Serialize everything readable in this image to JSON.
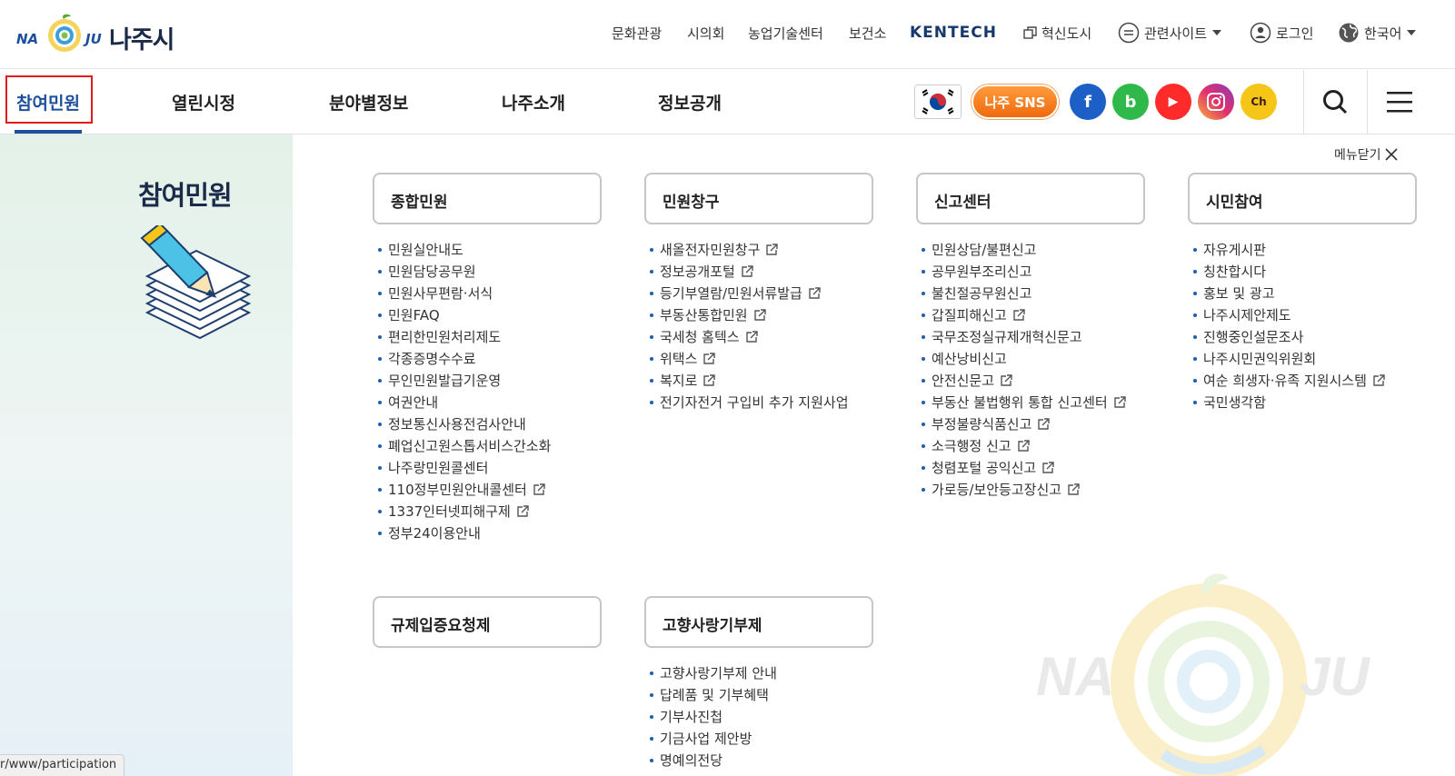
{
  "site": {
    "logo_text": "나주시",
    "logo_na": "NA",
    "logo_ju": "JU"
  },
  "utility": [
    "문화관광",
    "시의회",
    "농업기술센터",
    "보건소"
  ],
  "kentech": "KENTECH",
  "innovation": "혁신도시",
  "related": "관련사이트",
  "login": "로그인",
  "language": "한국어",
  "nav": {
    "items": [
      "참여민원",
      "열린시정",
      "분야별정보",
      "나주소개",
      "정보공개"
    ],
    "active": "참여민원"
  },
  "sns": {
    "najusns": "나주 SNS",
    "facebook": "f",
    "band": "b",
    "youtube": "▶",
    "kakao": "Ch"
  },
  "menu": {
    "side_title": "참여민원",
    "close_label": "메뉴닫기",
    "categories": [
      {
        "title": "종합민원",
        "links": [
          {
            "label": "민원실안내도"
          },
          {
            "label": "민원담당공무원"
          },
          {
            "label": "민원사무편람·서식"
          },
          {
            "label": "민원FAQ"
          },
          {
            "label": "편리한민원처리제도"
          },
          {
            "label": "각종증명수수료"
          },
          {
            "label": "무인민원발급기운영"
          },
          {
            "label": "여권안내"
          },
          {
            "label": "정보통신사용전검사안내"
          },
          {
            "label": "폐업신고원스톱서비스간소화"
          },
          {
            "label": "나주랑민원콜센터"
          },
          {
            "label": "110정부민원안내콜센터",
            "ext": true
          },
          {
            "label": "1337인터넷피해구제",
            "ext": true
          },
          {
            "label": "정부24이용안내"
          }
        ]
      },
      {
        "title": "민원창구",
        "links": [
          {
            "label": "새올전자민원창구",
            "ext": true
          },
          {
            "label": "정보공개포털",
            "ext": true
          },
          {
            "label": "등기부열람/민원서류발급",
            "ext": true
          },
          {
            "label": "부동산통합민원",
            "ext": true
          },
          {
            "label": "국세청 홈텍스",
            "ext": true
          },
          {
            "label": "위택스",
            "ext": true
          },
          {
            "label": "복지로",
            "ext": true
          },
          {
            "label": "전기자전거 구입비 추가 지원사업"
          }
        ]
      },
      {
        "title": "신고센터",
        "links": [
          {
            "label": "민원상담/불편신고"
          },
          {
            "label": "공무원부조리신고"
          },
          {
            "label": "불친절공무원신고"
          },
          {
            "label": "갑질피해신고",
            "ext": true
          },
          {
            "label": "국무조정실규제개혁신문고"
          },
          {
            "label": "예산낭비신고"
          },
          {
            "label": "안전신문고",
            "ext": true
          },
          {
            "label": "부동산 불법행위 통합 신고센터",
            "ext": true
          },
          {
            "label": "부정불량식품신고",
            "ext": true
          },
          {
            "label": "소극행정 신고",
            "ext": true
          },
          {
            "label": "청렴포털 공익신고",
            "ext": true
          },
          {
            "label": "가로등/보안등고장신고",
            "ext": true
          }
        ]
      },
      {
        "title": "시민참여",
        "links": [
          {
            "label": "자유게시판"
          },
          {
            "label": "칭찬합시다"
          },
          {
            "label": "홍보 및 광고"
          },
          {
            "label": "나주시제안제도"
          },
          {
            "label": "진행중인설문조사"
          },
          {
            "label": "나주시민권익위원회"
          },
          {
            "label": "여순 희생자·유족 지원시스템",
            "ext": true
          },
          {
            "label": "국민생각함"
          }
        ]
      },
      {
        "title": "규제입증요청제",
        "links": []
      },
      {
        "title": "고향사랑기부제",
        "links": [
          {
            "label": "고향사랑기부제 안내"
          },
          {
            "label": "답례품 및 기부혜택"
          },
          {
            "label": "기부사진첩"
          },
          {
            "label": "기금사업 제안방"
          },
          {
            "label": "명예의전당"
          }
        ]
      }
    ]
  },
  "watermark": {
    "na": "NA",
    "ju": "JU"
  },
  "status_url": "r/www/participation"
}
